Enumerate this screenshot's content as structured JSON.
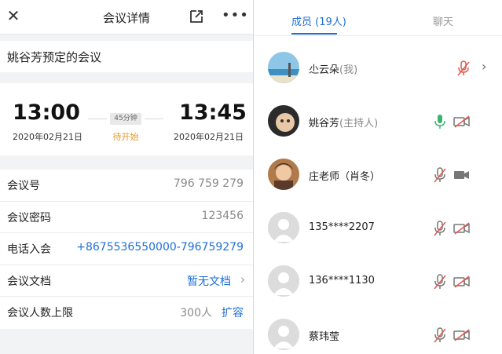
{
  "header": {
    "title": "会议详情",
    "close_icon": "close-icon",
    "share_icon": "share-icon",
    "more_icon": "more-icon"
  },
  "meeting": {
    "subject": "姚谷芳预定的会议",
    "start_time": "13:00",
    "start_date": "2020年02月21日",
    "end_time": "13:45",
    "end_date": "2020年02月21日",
    "duration": "45分钟",
    "status": "待开始"
  },
  "info_rows": {
    "meeting_id": {
      "label": "会议号",
      "value": "796 759 279"
    },
    "password": {
      "label": "会议密码",
      "value": "123456"
    },
    "dial_in": {
      "label": "电话入会",
      "value": "+8675536550000-796759279"
    },
    "documents": {
      "label": "会议文档",
      "value": "暂无文档"
    },
    "capacity": {
      "label": "会议人数上限",
      "value": "300人",
      "action": "扩容"
    }
  },
  "tabs": {
    "members": "成员 (19人)",
    "chat": "聊天"
  },
  "members": [
    {
      "name": "尐云朵",
      "tag": "(我)"
    },
    {
      "name": "姚谷芳",
      "tag": "(主持人)"
    },
    {
      "name": "庄老师（肖冬）",
      "tag": ""
    },
    {
      "name": "135****2207",
      "tag": ""
    },
    {
      "name": "136****1130",
      "tag": ""
    },
    {
      "name": "蔡玮莹",
      "tag": ""
    }
  ],
  "colors": {
    "accent_blue": "#1e6fd6",
    "status_orange": "#e69a2e",
    "muted_red": "#e05a4f",
    "mic_on_green": "#3cb371"
  }
}
